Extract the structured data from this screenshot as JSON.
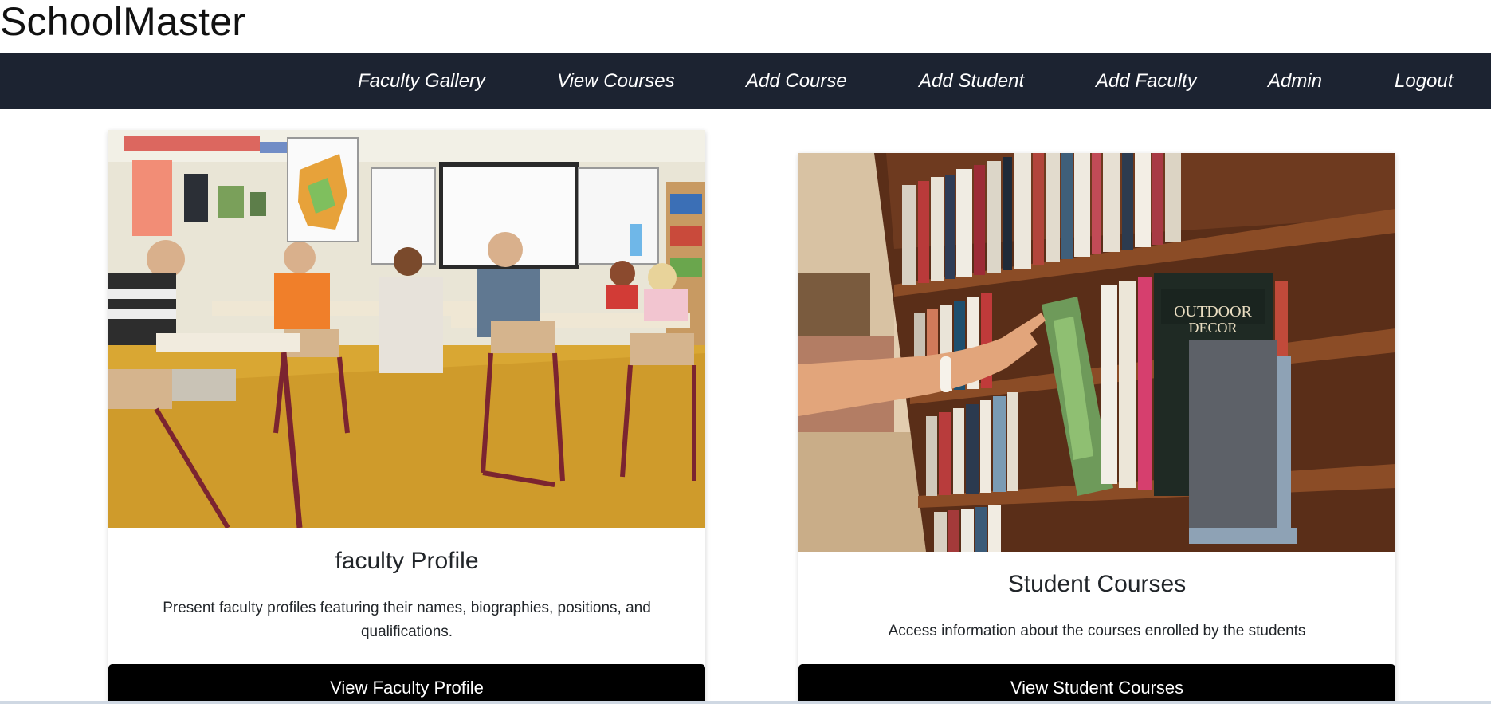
{
  "app": {
    "brand": "SchoolMaster"
  },
  "nav": {
    "items": [
      {
        "label": "Faculty Gallery"
      },
      {
        "label": "View Courses"
      },
      {
        "label": "Add Course"
      },
      {
        "label": "Add Student"
      },
      {
        "label": "Add Faculty"
      },
      {
        "label": "Admin"
      },
      {
        "label": "Logout"
      }
    ],
    "background": "#1c2331"
  },
  "cards": [
    {
      "image": "classroom-photo",
      "title": "faculty Profile",
      "text": "Present faculty profiles featuring their names, biographies, positions, and qualifications.",
      "button": "View Faculty Profile"
    },
    {
      "image": "library-bookshelf-photo",
      "title": "Student Courses",
      "text": "Access information about the courses enrolled by the students",
      "button": "View Student Courses"
    }
  ]
}
